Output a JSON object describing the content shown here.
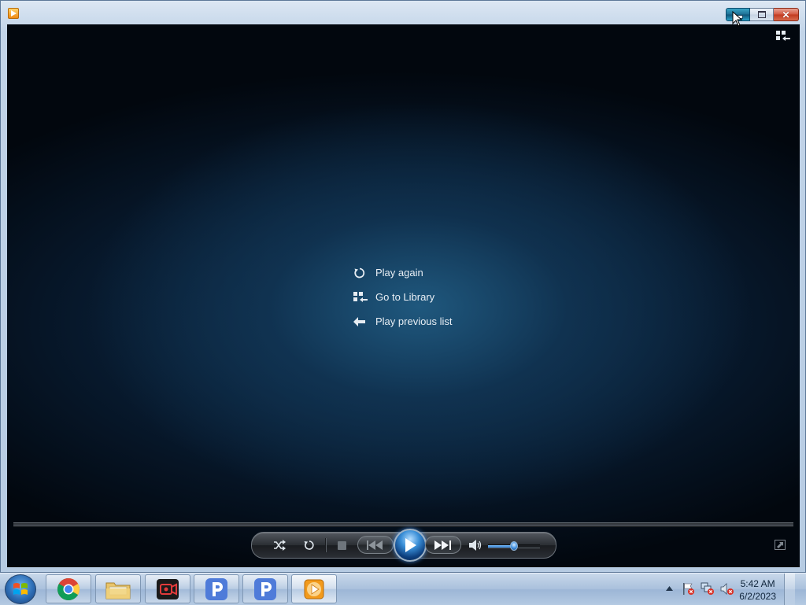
{
  "window": {
    "title": "",
    "app_icon": "windows-media-player-icon",
    "buttons": [
      "minimize",
      "maximize",
      "close"
    ]
  },
  "player": {
    "options": [
      {
        "label": "Play again",
        "icon": "replay-icon"
      },
      {
        "label": "Go to Library",
        "icon": "library-icon"
      },
      {
        "label": "Play previous list",
        "icon": "back-arrow-icon"
      }
    ],
    "switch_to_library_icon": "switch-to-library-icon",
    "controls": [
      "shuffle",
      "repeat",
      "stop",
      "previous",
      "play",
      "next",
      "mute"
    ],
    "volume_level": 0.5,
    "accent_color": "#3a8fd8"
  },
  "taskbar": {
    "items": [
      {
        "name": "chrome",
        "icon": "chrome-icon"
      },
      {
        "name": "file-explorer",
        "icon": "folder-icon"
      },
      {
        "name": "screen-recorder",
        "icon": "recorder-icon"
      },
      {
        "name": "app-p-1",
        "icon": "p-app-icon"
      },
      {
        "name": "app-p-2",
        "icon": "p-app-icon"
      },
      {
        "name": "windows-media-player",
        "icon": "windows-media-player-icon"
      }
    ],
    "clock": {
      "time": "5:42 AM",
      "date": "6/2/2023"
    }
  }
}
